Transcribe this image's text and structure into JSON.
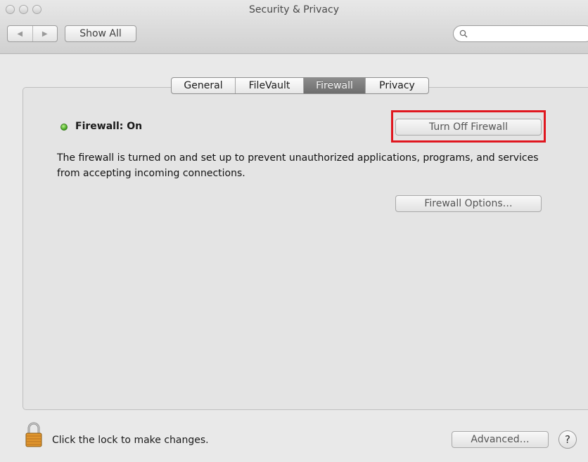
{
  "window": {
    "title": "Security & Privacy"
  },
  "toolbar": {
    "back_glyph": "◀",
    "forward_glyph": "▶",
    "show_all_label": "Show All",
    "search_placeholder": "",
    "search_value": ""
  },
  "tabs": [
    {
      "label": "General",
      "selected": false
    },
    {
      "label": "FileVault",
      "selected": false
    },
    {
      "label": "Firewall",
      "selected": true
    },
    {
      "label": "Privacy",
      "selected": false
    }
  ],
  "firewall": {
    "status_label": "Firewall: On",
    "status_color": "#3da01a",
    "toggle_button_label": "Turn Off Firewall",
    "description": "The firewall is turned on and set up to prevent unauthorized applications, programs, and services from accepting incoming connections.",
    "options_button_label": "Firewall Options…",
    "highlight_color": "#e0171f"
  },
  "footer": {
    "lock_text": "Click the lock to make changes.",
    "advanced_label": "Advanced…",
    "help_label": "?"
  },
  "icons": [
    "close-button-icon",
    "minimize-button-icon",
    "zoom-button-icon",
    "back-arrow-icon",
    "forward-arrow-icon",
    "search-icon",
    "status-dot-icon",
    "lock-icon",
    "help-icon"
  ]
}
